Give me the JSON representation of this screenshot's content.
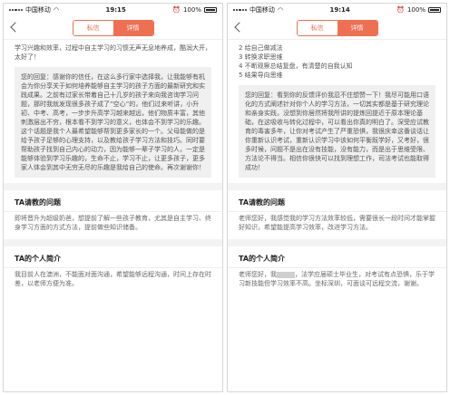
{
  "left": {
    "status": {
      "carrier": "中国移动",
      "time": "19:15",
      "battery": "100%"
    },
    "tabs": [
      {
        "label": "私信"
      },
      {
        "label": "详情"
      }
    ],
    "intro_text": "学习兴趣和效率，过程中自主学习的习惯无声无息地养成，酷润大开，太好了！",
    "reply": "您的回复：感谢你的信任，在这么多行家中选择我，让我能够有机会为你分享关于如何培养能够自主学习的孩子方面的最新研究和实践成果。之前有过家长带着自己十几岁的孩子来向我咨询学习问题，那时我就发现很多孩子成了“空心”的，他们过来听讲，小升初、中考、高考，一步步升高学习越来越远，他们物质丰富，其他刺激层出不穷，根本看不到学习的意义，也体会不到学习的乐趣。这个话题是我个人最希望能够帮到更多家长的一个。父母能做的是给予孩子足够的心理支持，以及教给孩子学习方法和技巧。同时要帮助孩子找到自己内心的动力，因为能够一辈子学习的人，一定是能够体验到学习乐趣的，生命不止，学习不止，让更多孩子，更多家人体会到其中无穷无尽的乐趣是我给自己的使命。再次谢谢你！",
    "sections": [
      {
        "title": "TA请教的问题",
        "body": "即将晋升为超级奶爸，想提前了解一些孩子教育，尤其是自主学习、终身学习方面的方式方法，提前做些知识储备。"
      },
      {
        "title": "TA的个人简介",
        "body": "我目前人在澳洲，不能面对面沟通，希望能够远程沟通，时间上存在时差，以老师方便为准。"
      }
    ]
  },
  "right": {
    "status": {
      "carrier": "中国移动",
      "time": "19:14",
      "battery": "100%"
    },
    "tabs": [
      {
        "label": "私信"
      },
      {
        "label": "详情"
      }
    ],
    "list": [
      "2 给自己做减法",
      "3 转换求职思维",
      "4 不断观察总结复盘，有清楚的自我认知",
      "5 结果导向思维"
    ],
    "reply": "您的回复：看到你的反馈评价我忍不住想赞一下！我尽可能用口语化的方式阐述针对你个人的学习方法，一切其实都是基于研究理论和亲身实践，没想到你居然将我所讲的提炼回提近于原本理论基础，在这吸收与转化过程中，可以看出你真的明白了。深受应试教育的毒害多年，让你对考试产生了严重恐惧，我很庆幸这番谈话让你重新认识考试，重新认识学习中该如何平衡既学好，又考好，很多时候，问题不是出在没有技能，没有能力，而是出于思维受限、方法论不得当。相信你很快可以找到理想工作，司法考试也能取得成功！",
    "sections": [
      {
        "title": "TA请教的问题",
        "body": "老师您好，我感觉我的学习方法效率较低，需要很长一段时间才能掌握好知识，希望能提高学习效率，改进学习方法。"
      },
      {
        "title": "TA的个人简介",
        "body_prefix": "老师您好，我",
        "body_suffix": "，法学应届硕士毕业生，对考试有点恐惧，乐于学习新技能但学习效率不高。坐标深圳，可面谈可远程交流，谢谢。"
      }
    ]
  }
}
